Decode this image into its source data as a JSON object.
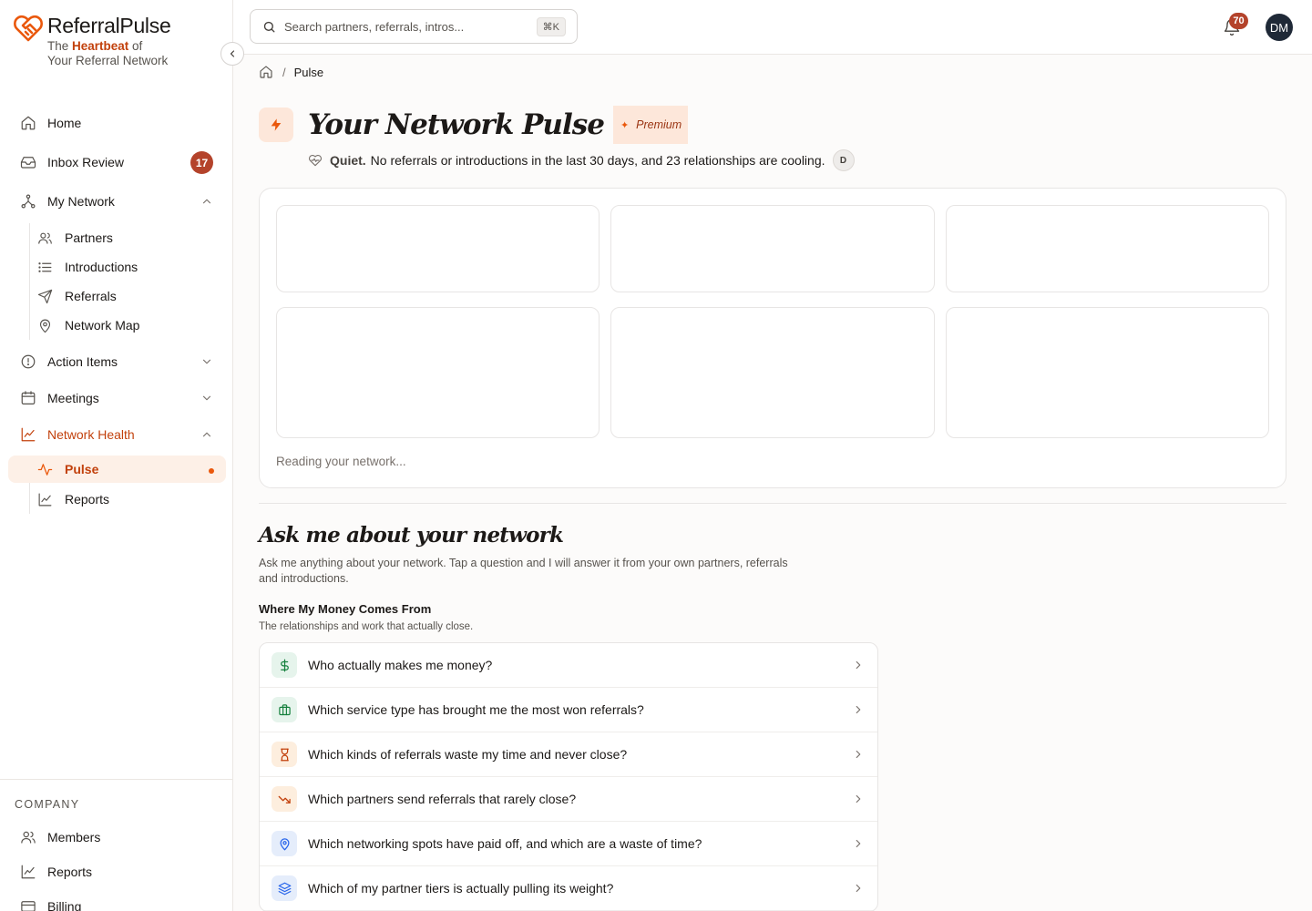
{
  "brand": {
    "name": "ReferralPulse",
    "tag_pre": "The ",
    "tag_hl": "Heartbeat",
    "tag_post": " of",
    "tag_line2": "Your Referral Network"
  },
  "nav": {
    "home": "Home",
    "inbox": "Inbox Review",
    "inbox_count": "17",
    "my_network": "My Network",
    "partners": "Partners",
    "introductions": "Introductions",
    "referrals": "Referrals",
    "network_map": "Network Map",
    "action_items": "Action Items",
    "meetings": "Meetings",
    "network_health": "Network Health",
    "pulse": "Pulse",
    "reports": "Reports"
  },
  "company": {
    "label": "COMPANY",
    "members": "Members",
    "reports": "Reports",
    "billing": "Billing"
  },
  "topbar": {
    "search_placeholder": "Search partners, referrals, intros...",
    "shortcut": "⌘K",
    "notifications": "70",
    "avatar": "DM"
  },
  "breadcrumb": {
    "current": "Pulse"
  },
  "page": {
    "title": "Your Network Pulse",
    "badge": "Premium",
    "status_label": "Quiet.",
    "status_text": "No referrals or introductions in the last 30 days, and 23 relationships are cooling.",
    "status_avatar": "D",
    "loading": "Reading your network..."
  },
  "ask": {
    "title": "Ask me about your network",
    "desc": "Ask me anything about your network. Tap a question and I will answer it from your own partners, referrals and introductions.",
    "group_title": "Where My Money Comes From",
    "group_sub": "The relationships and work that actually close.",
    "questions": [
      {
        "text": "Who actually makes me money?",
        "icon": "dollar-icon",
        "color": "#15803d"
      },
      {
        "text": "Which service type has brought me the most won referrals?",
        "icon": "briefcase-icon",
        "color": "#15803d"
      },
      {
        "text": "Which kinds of referrals waste my time and never close?",
        "icon": "hourglass-icon",
        "color": "#c2410c"
      },
      {
        "text": "Which partners send referrals that rarely close?",
        "icon": "trending-down-icon",
        "color": "#c2410c"
      },
      {
        "text": "Which networking spots have paid off, and which are a waste of time?",
        "icon": "map-pin-icon",
        "color": "#2563eb"
      },
      {
        "text": "Which of my partner tiers is actually pulling its weight?",
        "icon": "layers-icon",
        "color": "#2563eb"
      }
    ]
  }
}
